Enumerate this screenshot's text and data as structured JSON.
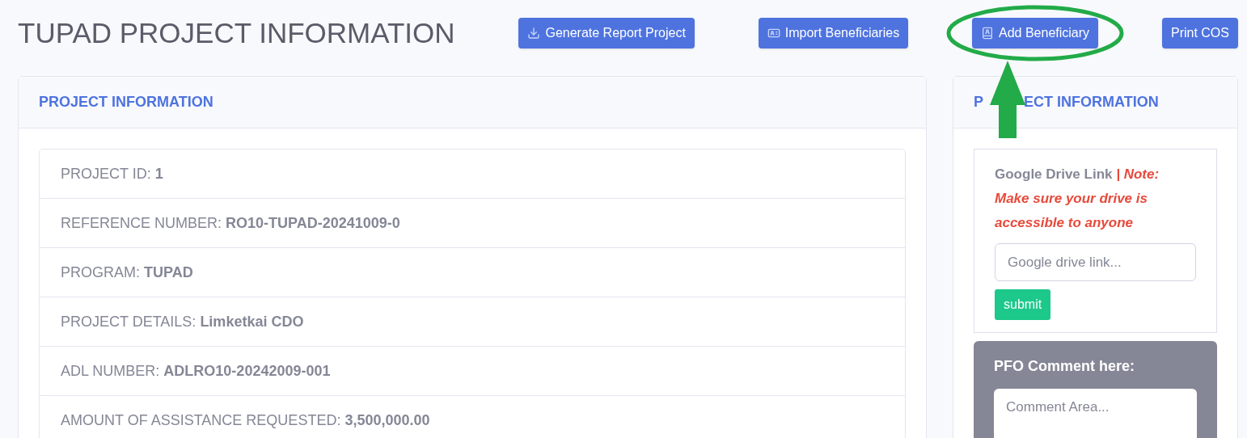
{
  "page_title": "TUPAD PROJECT INFORMATION",
  "actions": [
    {
      "label": "Generate Report Project",
      "highlighted": false
    },
    {
      "label": "Import Beneficiaries",
      "highlighted": false
    },
    {
      "label": "Add Beneficiary",
      "highlighted": true
    },
    {
      "label": "Print COS",
      "highlighted": false
    }
  ],
  "main_card": {
    "title": "PROJECT INFORMATION",
    "rows": [
      "PROJECT ID: **1**",
      "REFERENCE NUMBER: **RO10-TUPAD-20241009-0**",
      "PROGRAM: **TUPAD**",
      "PROJECT DETAILS: **Limketkai CDO**",
      "ADL NUMBER: **ADLRO10-20242009-001**",
      "AMOUNT OF ASSISTANCE REQUESTED: **3,500,000.00**"
    ]
  },
  "side_card": {
    "title_start": "P",
    "title_end": "ECT INFORMATION",
    "drive_label": "Google Drive Link",
    "drive_note": "| Note: Make sure your drive is accessible to anyone",
    "drive_field": {
      "placeholder": "Google drive link..."
    },
    "submit": "submit",
    "comment_title": "PFO Comment here:",
    "comment_field": {
      "placeholder": "Comment Area..."
    }
  }
}
